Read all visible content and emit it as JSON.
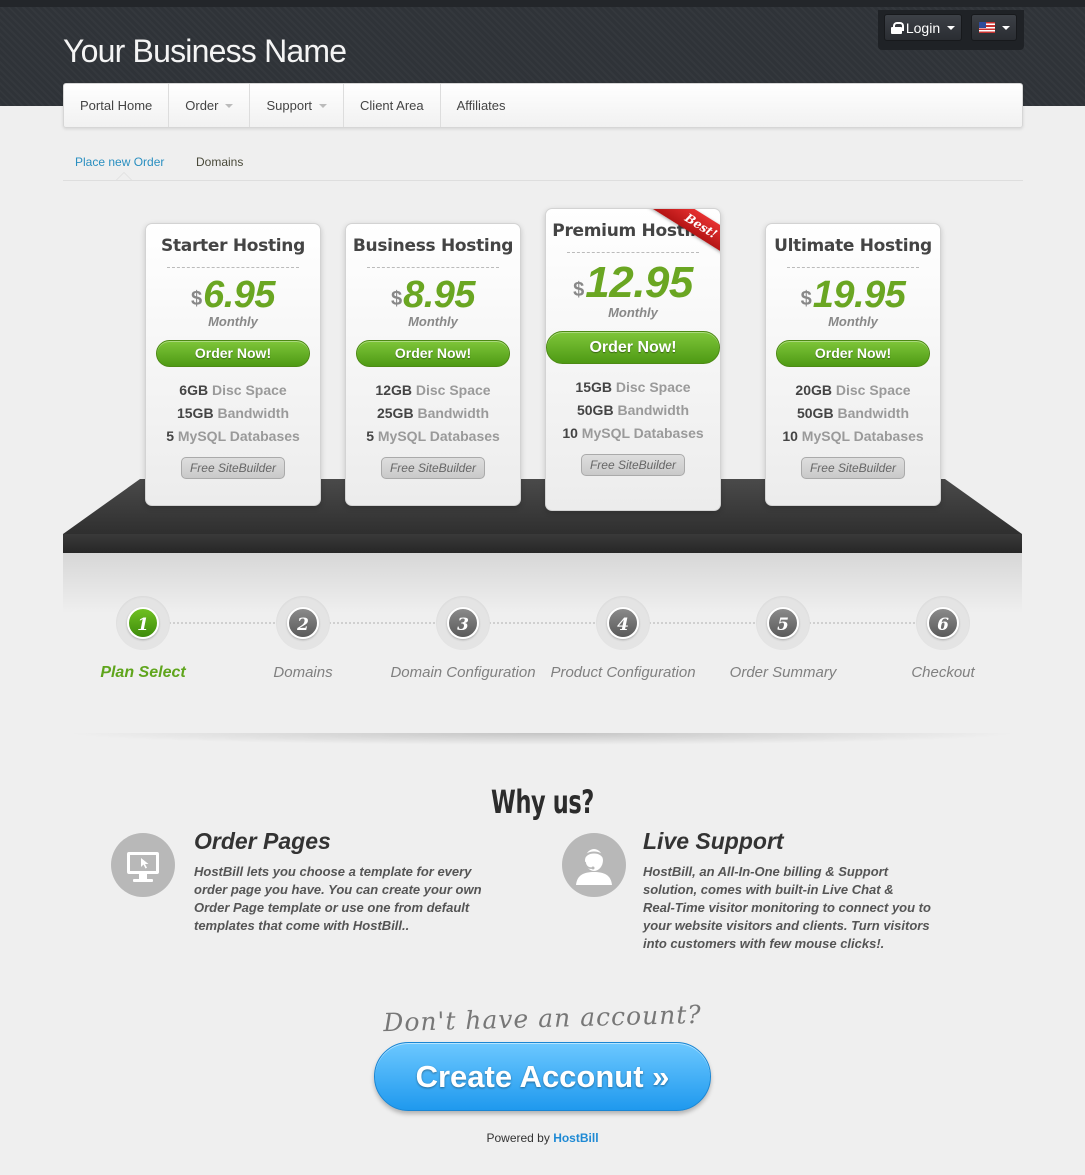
{
  "header": {
    "brand": "Your Business Name",
    "login_label": "Login"
  },
  "nav": {
    "items": [
      {
        "label": "Portal Home"
      },
      {
        "label": "Order"
      },
      {
        "label": "Support"
      },
      {
        "label": "Client Area"
      },
      {
        "label": "Affiliates"
      }
    ]
  },
  "subnav": {
    "active": "Place new Order",
    "other": "Domains"
  },
  "plans": [
    {
      "name": "Starter Hosting",
      "currency": "$",
      "price": "6.95",
      "cycle": "Monthly",
      "button": "Order Now!",
      "features": [
        {
          "num": "6GB",
          "label": "Disc Space"
        },
        {
          "num": "15GB",
          "label": "Bandwidth"
        },
        {
          "num": "5",
          "label": "MySQL Databases"
        }
      ],
      "badge": "Free SiteBuilder"
    },
    {
      "name": "Business Hosting",
      "currency": "$",
      "price": "8.95",
      "cycle": "Monthly",
      "button": "Order Now!",
      "features": [
        {
          "num": "12GB",
          "label": "Disc Space"
        },
        {
          "num": "25GB",
          "label": "Bandwidth"
        },
        {
          "num": "5",
          "label": "MySQL Databases"
        }
      ],
      "badge": "Free SiteBuilder"
    },
    {
      "name": "Premium Hosting",
      "currency": "$",
      "price": "12.95",
      "cycle": "Monthly",
      "button": "Order Now!",
      "features": [
        {
          "num": "15GB",
          "label": "Disc Space"
        },
        {
          "num": "50GB",
          "label": "Bandwidth"
        },
        {
          "num": "10",
          "label": "MySQL Databases"
        }
      ],
      "badge": "Free SiteBuilder",
      "ribbon": "Best!"
    },
    {
      "name": "Ultimate Hosting",
      "currency": "$",
      "price": "19.95",
      "cycle": "Monthly",
      "button": "Order Now!",
      "features": [
        {
          "num": "20GB",
          "label": "Disc Space"
        },
        {
          "num": "50GB",
          "label": "Bandwidth"
        },
        {
          "num": "10",
          "label": "MySQL Databases"
        }
      ],
      "badge": "Free SiteBuilder"
    }
  ],
  "steps": [
    {
      "num": "1",
      "label": "Plan Select"
    },
    {
      "num": "2",
      "label": "Domains"
    },
    {
      "num": "3",
      "label": "Domain Configuration"
    },
    {
      "num": "4",
      "label": "Product Configuration"
    },
    {
      "num": "5",
      "label": "Order Summary"
    },
    {
      "num": "6",
      "label": "Checkout"
    }
  ],
  "why": {
    "title": "Why us?",
    "features": [
      {
        "icon": "monitor-icon",
        "title": "Order Pages",
        "lines": [
          "HostBill lets you choose a template for every",
          "order page you have. You can create your own",
          "Order Page template or use one from default",
          "templates that come with HostBill.."
        ]
      },
      {
        "icon": "support-agent-icon",
        "title": "Live Support",
        "lines": [
          "HostBill, an All-In-One billing & Support",
          "solution, comes with built-in Live Chat &",
          "Real-Time visitor monitoring to connect you to",
          "your website visitors and clients. Turn visitors",
          "into customers with few mouse clicks!."
        ]
      }
    ]
  },
  "cta": {
    "question": "Don't have an account?",
    "button": "Create Acconut »"
  },
  "footer": {
    "powered_prefix": "Powered by",
    "powered_brand": "HostBill"
  },
  "colors": {
    "accent_green": "#6aa622",
    "link_blue": "#2a8fc0",
    "cta_blue": "#1f99ee",
    "ribbon_red": "#d42020"
  }
}
